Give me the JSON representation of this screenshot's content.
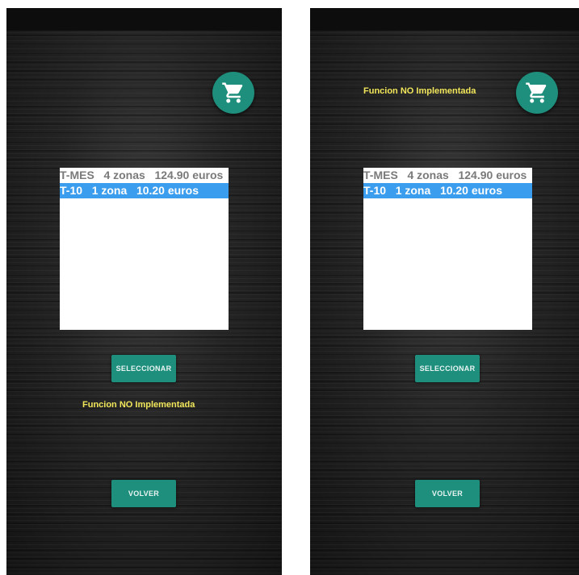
{
  "screens": [
    {
      "list_items": [
        {
          "code": "T-MES",
          "zones": "4 zonas",
          "price": "124.90 euros",
          "selected": false
        },
        {
          "code": "T-10",
          "zones": "1 zona",
          "price": "10.20 euros",
          "selected": true
        }
      ],
      "select_button": "SELECCIONAR",
      "back_button": "VOLVER",
      "message": "Funcion NO Implementada",
      "message_position": "below-select-button",
      "cart_icon": "shopping-cart-icon"
    },
    {
      "list_items": [
        {
          "code": "T-MES",
          "zones": "4 zonas",
          "price": "124.90 euros",
          "selected": false
        },
        {
          "code": "T-10",
          "zones": "1 zona",
          "price": "10.20 euros",
          "selected": true
        }
      ],
      "select_button": "SELECCIONAR",
      "back_button": "VOLVER",
      "message": "Funcion NO Implementada",
      "message_position": "top-beside-cart",
      "cart_icon": "shopping-cart-icon"
    }
  ],
  "colors": {
    "accent": "#1f8f7d",
    "selection": "#3b9ded",
    "message": "#f1e65a"
  }
}
